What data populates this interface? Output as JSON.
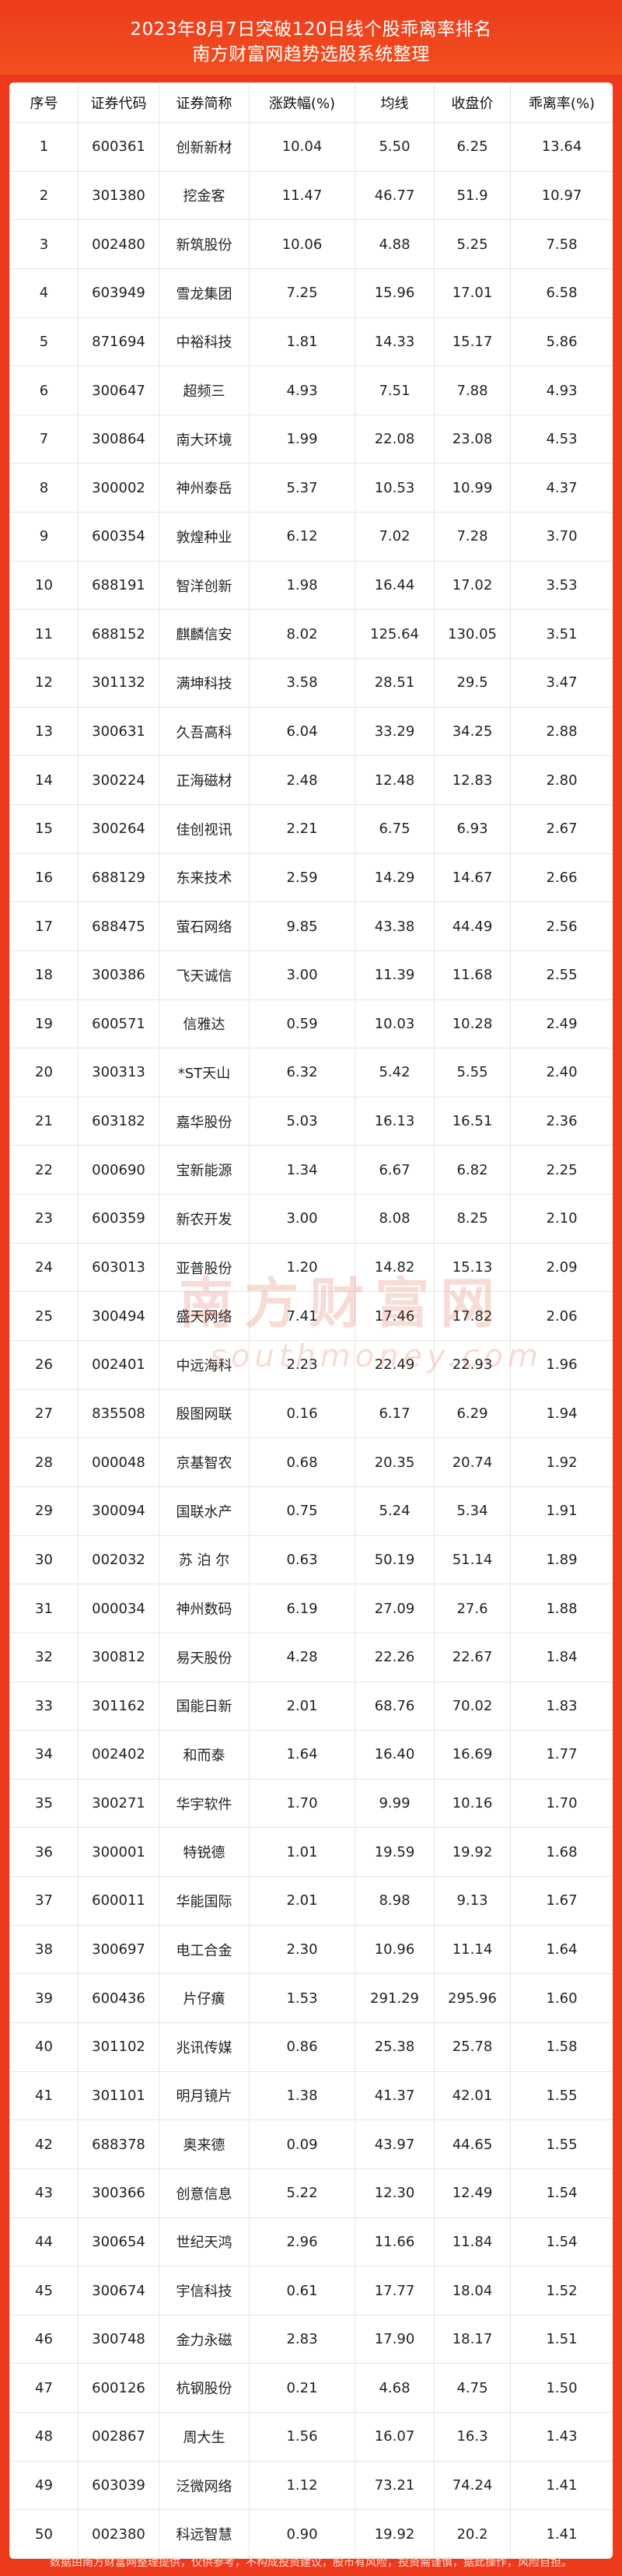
{
  "header": {
    "title_line1": "2023年8月7日突破120日线个股乖离率排名",
    "title_line2": "南方财富网趋势选股系统整理"
  },
  "table": {
    "columns": [
      "序号",
      "证券代码",
      "证券简称",
      "涨跌幅(%)",
      "均线",
      "收盘价",
      "乖离率(%)"
    ],
    "rows": [
      [
        "1",
        "600361",
        "创新新材",
        "10.04",
        "5.50",
        "6.25",
        "13.64"
      ],
      [
        "2",
        "301380",
        "挖金客",
        "11.47",
        "46.77",
        "51.9",
        "10.97"
      ],
      [
        "3",
        "002480",
        "新筑股份",
        "10.06",
        "4.88",
        "5.25",
        "7.58"
      ],
      [
        "4",
        "603949",
        "雪龙集团",
        "7.25",
        "15.96",
        "17.01",
        "6.58"
      ],
      [
        "5",
        "871694",
        "中裕科技",
        "1.81",
        "14.33",
        "15.17",
        "5.86"
      ],
      [
        "6",
        "300647",
        "超频三",
        "4.93",
        "7.51",
        "7.88",
        "4.93"
      ],
      [
        "7",
        "300864",
        "南大环境",
        "1.99",
        "22.08",
        "23.08",
        "4.53"
      ],
      [
        "8",
        "300002",
        "神州泰岳",
        "5.37",
        "10.53",
        "10.99",
        "4.37"
      ],
      [
        "9",
        "600354",
        "敦煌种业",
        "6.12",
        "7.02",
        "7.28",
        "3.70"
      ],
      [
        "10",
        "688191",
        "智洋创新",
        "1.98",
        "16.44",
        "17.02",
        "3.53"
      ],
      [
        "11",
        "688152",
        "麒麟信安",
        "8.02",
        "125.64",
        "130.05",
        "3.51"
      ],
      [
        "12",
        "301132",
        "满坤科技",
        "3.58",
        "28.51",
        "29.5",
        "3.47"
      ],
      [
        "13",
        "300631",
        "久吾高科",
        "6.04",
        "33.29",
        "34.25",
        "2.88"
      ],
      [
        "14",
        "300224",
        "正海磁材",
        "2.48",
        "12.48",
        "12.83",
        "2.80"
      ],
      [
        "15",
        "300264",
        "佳创视讯",
        "2.21",
        "6.75",
        "6.93",
        "2.67"
      ],
      [
        "16",
        "688129",
        "东来技术",
        "2.59",
        "14.29",
        "14.67",
        "2.66"
      ],
      [
        "17",
        "688475",
        "萤石网络",
        "9.85",
        "43.38",
        "44.49",
        "2.56"
      ],
      [
        "18",
        "300386",
        "飞天诚信",
        "3.00",
        "11.39",
        "11.68",
        "2.55"
      ],
      [
        "19",
        "600571",
        "信雅达",
        "0.59",
        "10.03",
        "10.28",
        "2.49"
      ],
      [
        "20",
        "300313",
        "*ST天山",
        "6.32",
        "5.42",
        "5.55",
        "2.40"
      ],
      [
        "21",
        "603182",
        "嘉华股份",
        "5.03",
        "16.13",
        "16.51",
        "2.36"
      ],
      [
        "22",
        "000690",
        "宝新能源",
        "1.34",
        "6.67",
        "6.82",
        "2.25"
      ],
      [
        "23",
        "600359",
        "新农开发",
        "3.00",
        "8.08",
        "8.25",
        "2.10"
      ],
      [
        "24",
        "603013",
        "亚普股份",
        "1.20",
        "14.82",
        "15.13",
        "2.09"
      ],
      [
        "25",
        "300494",
        "盛天网络",
        "7.41",
        "17.46",
        "17.82",
        "2.06"
      ],
      [
        "26",
        "002401",
        "中远海科",
        "2.23",
        "22.49",
        "22.93",
        "1.96"
      ],
      [
        "27",
        "835508",
        "殷图网联",
        "0.16",
        "6.17",
        "6.29",
        "1.94"
      ],
      [
        "28",
        "000048",
        "京基智农",
        "0.68",
        "20.35",
        "20.74",
        "1.92"
      ],
      [
        "29",
        "300094",
        "国联水产",
        "0.75",
        "5.24",
        "5.34",
        "1.91"
      ],
      [
        "30",
        "002032",
        "苏 泊 尔",
        "0.63",
        "50.19",
        "51.14",
        "1.89"
      ],
      [
        "31",
        "000034",
        "神州数码",
        "6.19",
        "27.09",
        "27.6",
        "1.88"
      ],
      [
        "32",
        "300812",
        "易天股份",
        "4.28",
        "22.26",
        "22.67",
        "1.84"
      ],
      [
        "33",
        "301162",
        "国能日新",
        "2.01",
        "68.76",
        "70.02",
        "1.83"
      ],
      [
        "34",
        "002402",
        "和而泰",
        "1.64",
        "16.40",
        "16.69",
        "1.77"
      ],
      [
        "35",
        "300271",
        "华宇软件",
        "1.70",
        "9.99",
        "10.16",
        "1.70"
      ],
      [
        "36",
        "300001",
        "特锐德",
        "1.01",
        "19.59",
        "19.92",
        "1.68"
      ],
      [
        "37",
        "600011",
        "华能国际",
        "2.01",
        "8.98",
        "9.13",
        "1.67"
      ],
      [
        "38",
        "300697",
        "电工合金",
        "2.30",
        "10.96",
        "11.14",
        "1.64"
      ],
      [
        "39",
        "600436",
        "片仔癀",
        "1.53",
        "291.29",
        "295.96",
        "1.60"
      ],
      [
        "40",
        "301102",
        "兆讯传媒",
        "0.86",
        "25.38",
        "25.78",
        "1.58"
      ],
      [
        "41",
        "301101",
        "明月镜片",
        "1.38",
        "41.37",
        "42.01",
        "1.55"
      ],
      [
        "42",
        "688378",
        "奥来德",
        "0.09",
        "43.97",
        "44.65",
        "1.55"
      ],
      [
        "43",
        "300366",
        "创意信息",
        "5.22",
        "12.30",
        "12.49",
        "1.54"
      ],
      [
        "44",
        "300654",
        "世纪天鸿",
        "2.96",
        "11.66",
        "11.84",
        "1.54"
      ],
      [
        "45",
        "300674",
        "宇信科技",
        "0.61",
        "17.77",
        "18.04",
        "1.52"
      ],
      [
        "46",
        "300748",
        "金力永磁",
        "2.83",
        "17.90",
        "18.17",
        "1.51"
      ],
      [
        "47",
        "600126",
        "杭钢股份",
        "0.21",
        "4.68",
        "4.75",
        "1.50"
      ],
      [
        "48",
        "002867",
        "周大生",
        "1.56",
        "16.07",
        "16.3",
        "1.43"
      ],
      [
        "49",
        "603039",
        "泛微网络",
        "1.12",
        "73.21",
        "74.24",
        "1.41"
      ],
      [
        "50",
        "002380",
        "科远智慧",
        "0.90",
        "19.92",
        "20.2",
        "1.41"
      ]
    ]
  },
  "watermark": {
    "cn": "南方财富网",
    "en": "southmoney.com"
  },
  "footer": {
    "text": "数据由南方财富网整理提供，仅供参考，不构成投资建议，股市有风险，投资需谨慎，据此操作，风险自担。"
  },
  "colors": {
    "background": "#ee3a1c",
    "panel": "#ffffff",
    "border": "#e6e6e6"
  }
}
